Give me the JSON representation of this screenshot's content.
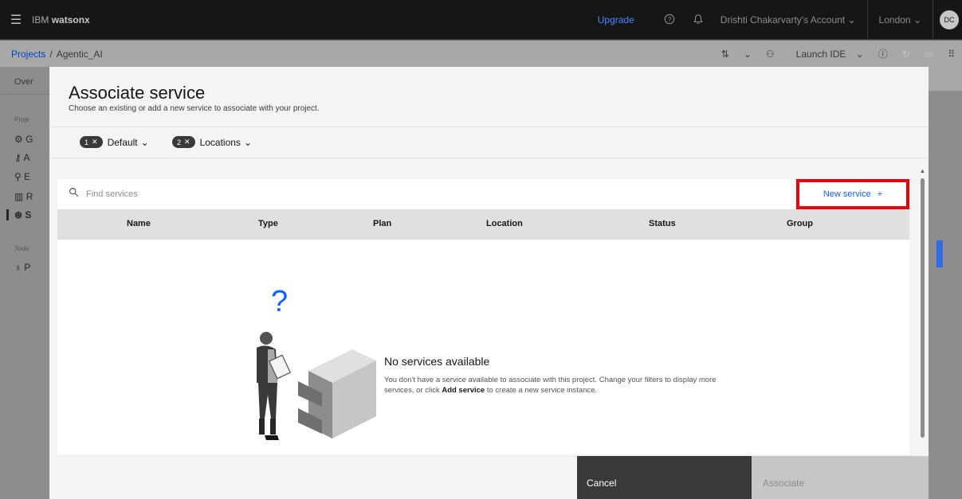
{
  "topbar": {
    "brand_prefix": "IBM",
    "brand_name": "watsonx",
    "upgrade": "Upgrade",
    "account": "Drishti Chakarvarty's Account",
    "region": "London",
    "avatar_initials": "DC"
  },
  "breadcrumb": {
    "projects": "Projects",
    "separator": "/",
    "current": "Agentic_AI",
    "launch_ide": "Launch IDE"
  },
  "sidebar": {
    "overview_tab": "Over",
    "project_section": "Proje",
    "tools_section": "Tools",
    "items": [
      "G",
      "A",
      "E",
      "R",
      "S",
      "P"
    ]
  },
  "modal": {
    "title": "Associate service",
    "description": "Choose an existing or add a new service to associate with your project.",
    "filters": [
      {
        "count": "1",
        "label": "Default"
      },
      {
        "count": "2",
        "label": "Locations"
      }
    ],
    "search_placeholder": "Find services",
    "new_service_label": "New service",
    "columns": [
      "Name",
      "Type",
      "Plan",
      "Location",
      "Status",
      "Group"
    ],
    "empty_title": "No services available",
    "empty_text_1": "You don't have a service available to associate with this project. Change your filters to display more services, or click ",
    "empty_text_bold": "Add service",
    "empty_text_2": " to create a new service instance.",
    "cancel_label": "Cancel",
    "associate_label": "Associate"
  },
  "colors": {
    "accent": "#0f62fe",
    "highlight_box": "#e8000b",
    "dark_button": "#393939",
    "disabled_button": "#c6c6c6"
  }
}
